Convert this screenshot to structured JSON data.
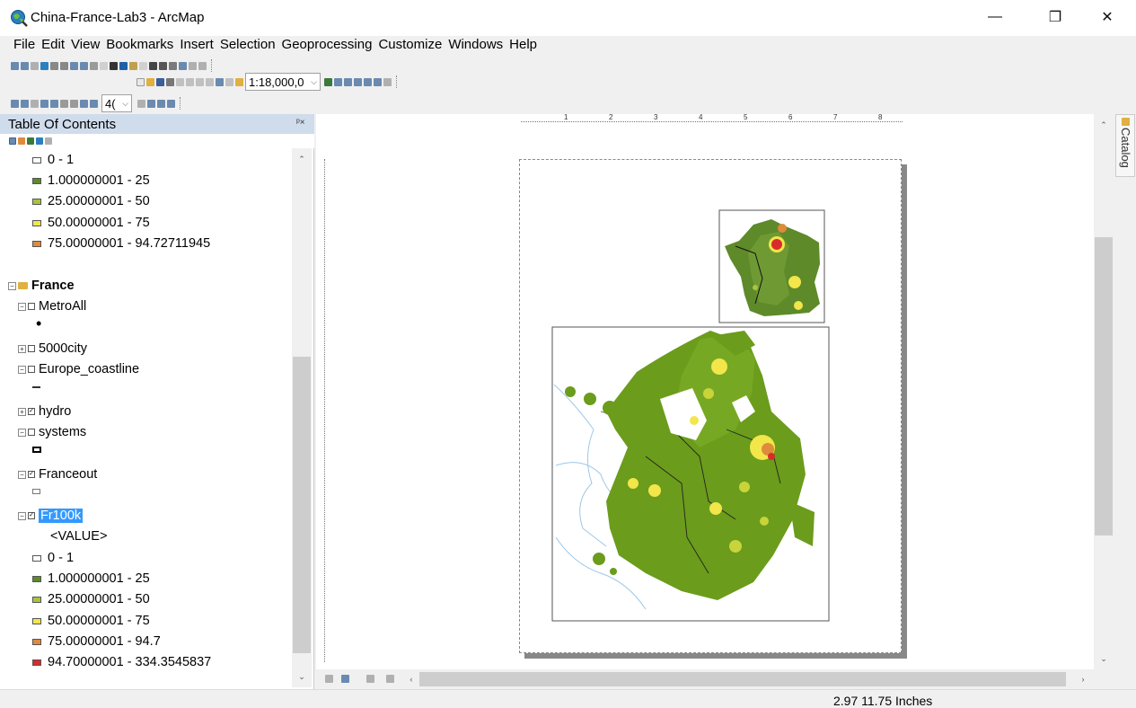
{
  "window": {
    "title": "China-France-Lab3 - ArcMap",
    "minimize": "—",
    "maximize": "❐",
    "close": "✕"
  },
  "menu": [
    "File",
    "Edit",
    "View",
    "Bookmarks",
    "Insert",
    "Selection",
    "Geoprocessing",
    "Customize",
    "Windows",
    "Help"
  ],
  "toolbar": {
    "scale": "1:18,000,0",
    "zoom_percent": "4("
  },
  "toc": {
    "title": "Table Of Contents",
    "pin": "ᵖ×",
    "top_legend": [
      {
        "label": "0 - 1",
        "color": "#ffffff"
      },
      {
        "label": "1.000000001 - 25",
        "color": "#5e8a2a"
      },
      {
        "label": "25.00000001 - 50",
        "color": "#a8c43a"
      },
      {
        "label": "50.00000001 - 75",
        "color": "#f2e64a"
      },
      {
        "label": "75.00000001 - 94.72711945",
        "color": "#e08a3c"
      }
    ],
    "group": "France",
    "layers": {
      "metroall": "MetroAll",
      "city5000": "5000city",
      "coastline": "Europe_coastline",
      "hydro": "hydro",
      "systems": "systems",
      "franceout": "Franceout",
      "fr100k": "Fr100k",
      "fr100k_field": "<VALUE>"
    },
    "bottom_legend": [
      {
        "label": "0 - 1",
        "color": "#ffffff"
      },
      {
        "label": "1.000000001 - 25",
        "color": "#5e8a2a"
      },
      {
        "label": "25.00000001 - 50",
        "color": "#a8c43a"
      },
      {
        "label": "50.00000001 - 75",
        "color": "#f2e64a"
      },
      {
        "label": "75.00000001 - 94.7",
        "color": "#e08a3c"
      },
      {
        "label": "94.70000001 - 334.3545837",
        "color": "#d92b2b"
      }
    ]
  },
  "side_tab": "Catalog",
  "status": {
    "coords": "2.97  11.75 Inches"
  }
}
